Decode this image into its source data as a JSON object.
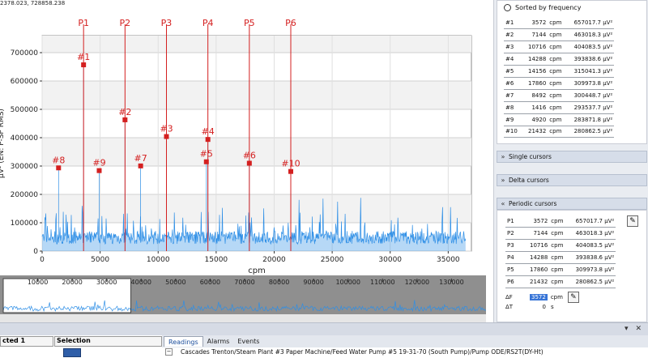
{
  "coordinates_readout": "2378.023, 728858.238",
  "chart_data": {
    "type": "line",
    "xlabel": "cpm",
    "ylabel": "µV² (EN: P-SP RMS)",
    "xlim": [
      0,
      37000
    ],
    "ylim": [
      0,
      760000
    ],
    "x_ticks": [
      0,
      5000,
      10000,
      15000,
      20000,
      25000,
      30000,
      35000
    ],
    "y_ticks": [
      0,
      100000,
      200000,
      300000,
      400000,
      500000,
      600000,
      700000
    ],
    "x_tick_labels": [
      "0",
      "5000",
      "10000",
      "15000",
      "20000",
      "25000",
      "30000",
      "35000"
    ],
    "y_tick_labels": [
      "0",
      "100000",
      "200000",
      "300000",
      "400000",
      "500000",
      "600000",
      "700000"
    ],
    "grid": true,
    "peaks": [
      {
        "label": "#1",
        "x": 3572,
        "y": 657017.7
      },
      {
        "label": "#2",
        "x": 7144,
        "y": 463018.3
      },
      {
        "label": "#3",
        "x": 10716,
        "y": 404083.5
      },
      {
        "label": "#4",
        "x": 14288,
        "y": 393838.6
      },
      {
        "label": "#5",
        "x": 14156,
        "y": 315041.3
      },
      {
        "label": "#6",
        "x": 17860,
        "y": 309973.8
      },
      {
        "label": "#7",
        "x": 8492,
        "y": 300448.7
      },
      {
        "label": "#8",
        "x": 1416,
        "y": 293537.7
      },
      {
        "label": "#9",
        "x": 4920,
        "y": 283871.8
      },
      {
        "label": "#10",
        "x": 21432,
        "y": 280862.5
      }
    ],
    "cursors": [
      {
        "label": "P1",
        "x": 3572
      },
      {
        "label": "P2",
        "x": 7144
      },
      {
        "label": "P3",
        "x": 10716
      },
      {
        "label": "P4",
        "x": 14288
      },
      {
        "label": "P5",
        "x": 17860
      },
      {
        "label": "P6",
        "x": 21432
      }
    ],
    "colors": {
      "spectrum": "#2f8fe6",
      "cursor": "#d42020",
      "peak": "#d42020",
      "plot_bg": "#f2f2f2"
    },
    "overview": {
      "x_ticks": [
        10000,
        20000,
        30000,
        40000,
        50000,
        60000,
        70000,
        80000,
        90000,
        100000,
        110000,
        120000,
        130000
      ],
      "x_tick_labels": [
        "10000",
        "20000",
        "30000",
        "40000",
        "50000",
        "60000",
        "70000",
        "80000",
        "90000",
        "100000",
        "110000",
        "120000",
        "130000"
      ],
      "xlim": [
        0,
        140000
      ],
      "window": [
        0,
        37000
      ]
    }
  },
  "sorted_panel": {
    "option_label": "Sorted by frequency",
    "rows": [
      {
        "idx": "#1",
        "freq": "3572",
        "unit": "cpm",
        "amp": "657017.7 µV²"
      },
      {
        "idx": "#2",
        "freq": "7144",
        "unit": "cpm",
        "amp": "463018.3 µV²"
      },
      {
        "idx": "#3",
        "freq": "10716",
        "unit": "cpm",
        "amp": "404083.5 µV²"
      },
      {
        "idx": "#4",
        "freq": "14288",
        "unit": "cpm",
        "amp": "393838.6 µV²"
      },
      {
        "idx": "#5",
        "freq": "14156",
        "unit": "cpm",
        "amp": "315041.3 µV²"
      },
      {
        "idx": "#6",
        "freq": "17860",
        "unit": "cpm",
        "amp": "309973.8 µV²"
      },
      {
        "idx": "#7",
        "freq": "8492",
        "unit": "cpm",
        "amp": "300448.7 µV²"
      },
      {
        "idx": "#8",
        "freq": "1416",
        "unit": "cpm",
        "amp": "293537.7 µV²"
      },
      {
        "idx": "#9",
        "freq": "4920",
        "unit": "cpm",
        "amp": "283871.8 µV²"
      },
      {
        "idx": "#10",
        "freq": "21432",
        "unit": "cpm",
        "amp": "280862.5 µV²"
      }
    ]
  },
  "sections": {
    "single": "Single cursors",
    "delta": "Delta cursors",
    "periodic": "Periodic cursors"
  },
  "periodic": {
    "rows": [
      {
        "idx": "P1",
        "freq": "3572",
        "unit": "cpm",
        "amp": "657017.7 µV²"
      },
      {
        "idx": "P2",
        "freq": "7144",
        "unit": "cpm",
        "amp": "463018.3 µV²"
      },
      {
        "idx": "P3",
        "freq": "10716",
        "unit": "cpm",
        "amp": "404083.5 µV²"
      },
      {
        "idx": "P4",
        "freq": "14288",
        "unit": "cpm",
        "amp": "393838.6 µV²"
      },
      {
        "idx": "P5",
        "freq": "17860",
        "unit": "cpm",
        "amp": "309973.8 µV²"
      },
      {
        "idx": "P6",
        "freq": "21432",
        "unit": "cpm",
        "amp": "280862.5 µV²"
      }
    ],
    "delta_f_label": "ΔF",
    "delta_f_value": "3572",
    "delta_f_unit": "cpm",
    "delta_t_label": "ΔT",
    "delta_t_value": "0",
    "delta_t_unit": "s"
  },
  "bottom": {
    "grid_headers": [
      "cted 1",
      "Selection"
    ],
    "tabs": [
      "Readings",
      "Alarms",
      "Events"
    ],
    "tree_path": "Cascades Trenton/Steam Plant #3 Paper Machine/Feed Water Pump #5 19-31-70 (South Pump)/Pump ODE/RS2T(DY-Ht)",
    "tree_toggle": "−"
  }
}
